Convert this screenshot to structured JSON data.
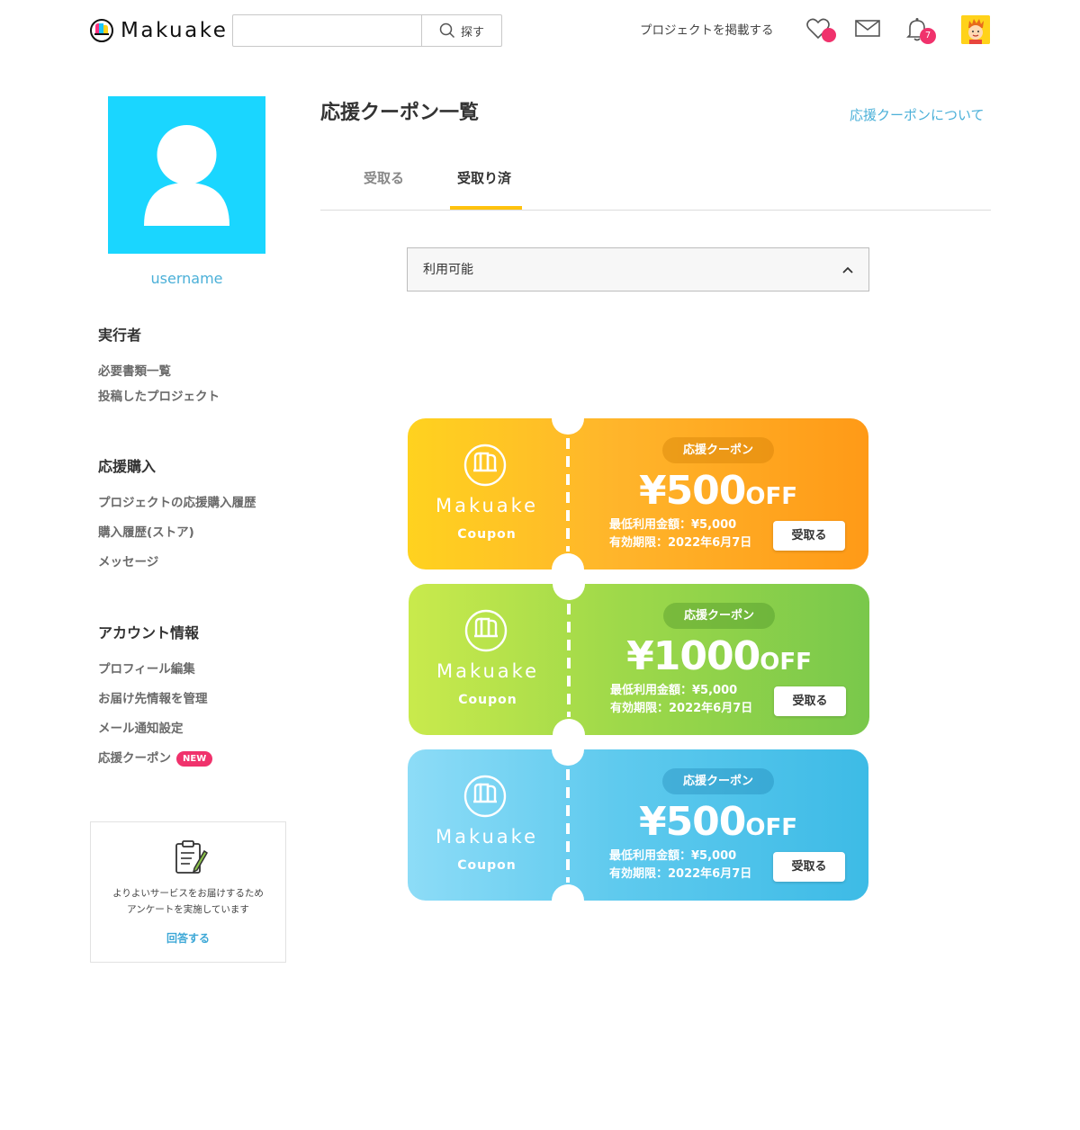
{
  "header": {
    "brand": "Makuake",
    "search": {
      "value": "",
      "button_label": "探す"
    },
    "post_project": "プロジェクトを掲載する",
    "notifications_count": "7",
    "icons": [
      "makuake-logo-icon",
      "search-icon",
      "heart-icon",
      "mail-icon",
      "bell-icon",
      "user-avatar"
    ]
  },
  "sidebar": {
    "username": "username",
    "sections": [
      {
        "title": "実行者",
        "items": [
          "必要書類一覧",
          "投稿したプロジェクト"
        ]
      },
      {
        "title": "応援購入",
        "items": [
          "プロジェクトの応援購入履歴",
          "購入履歴(ストア)",
          "メッセージ"
        ]
      },
      {
        "title": "アカウント情報",
        "items": [
          "プロフィール編集",
          "お届け先情報を管理",
          "メール通知設定",
          "応援クーポン"
        ]
      }
    ],
    "new_badge": "NEW",
    "survey": {
      "line1": "よりよいサービスをお届けするため",
      "line2": "アンケートを実施しています",
      "answer": "回答する"
    }
  },
  "main": {
    "title": "応援クーポン一覧",
    "about_link": "応援クーポンについて",
    "tabs": [
      {
        "label": "受取る",
        "active": false
      },
      {
        "label": "受取り済",
        "active": true
      }
    ],
    "filter": {
      "selected": "利用可能"
    },
    "coupons": [
      {
        "brand": "Makuake",
        "sub": "Coupon",
        "pill": "応援クーポン",
        "amount": "¥500",
        "off": "OFF",
        "min": "最低利用金額：¥5,000",
        "expiry": "有効期限：2022年6月7日",
        "button": "受取る",
        "color": "#ffb52b"
      },
      {
        "brand": "Makuake",
        "sub": "Coupon",
        "pill": "応援クーポン",
        "amount": "¥1000",
        "off": "OFF",
        "min": "最低利用金額：¥5,000",
        "expiry": "有効期限：2022年6月7日",
        "button": "受取る",
        "color": "#9fd94a"
      },
      {
        "brand": "Makuake",
        "sub": "Coupon",
        "pill": "応援クーポン",
        "amount": "¥500",
        "off": "OFF",
        "min": "最低利用金額：¥5,000",
        "expiry": "有効期限：2022年6月7日",
        "button": "受取る",
        "color": "#5fcaee"
      }
    ]
  },
  "colors": {
    "accent": "#ffc20e",
    "link": "#4bb0d8",
    "badge": "#f0326c",
    "avatar_bg": "#1ad6ff"
  }
}
